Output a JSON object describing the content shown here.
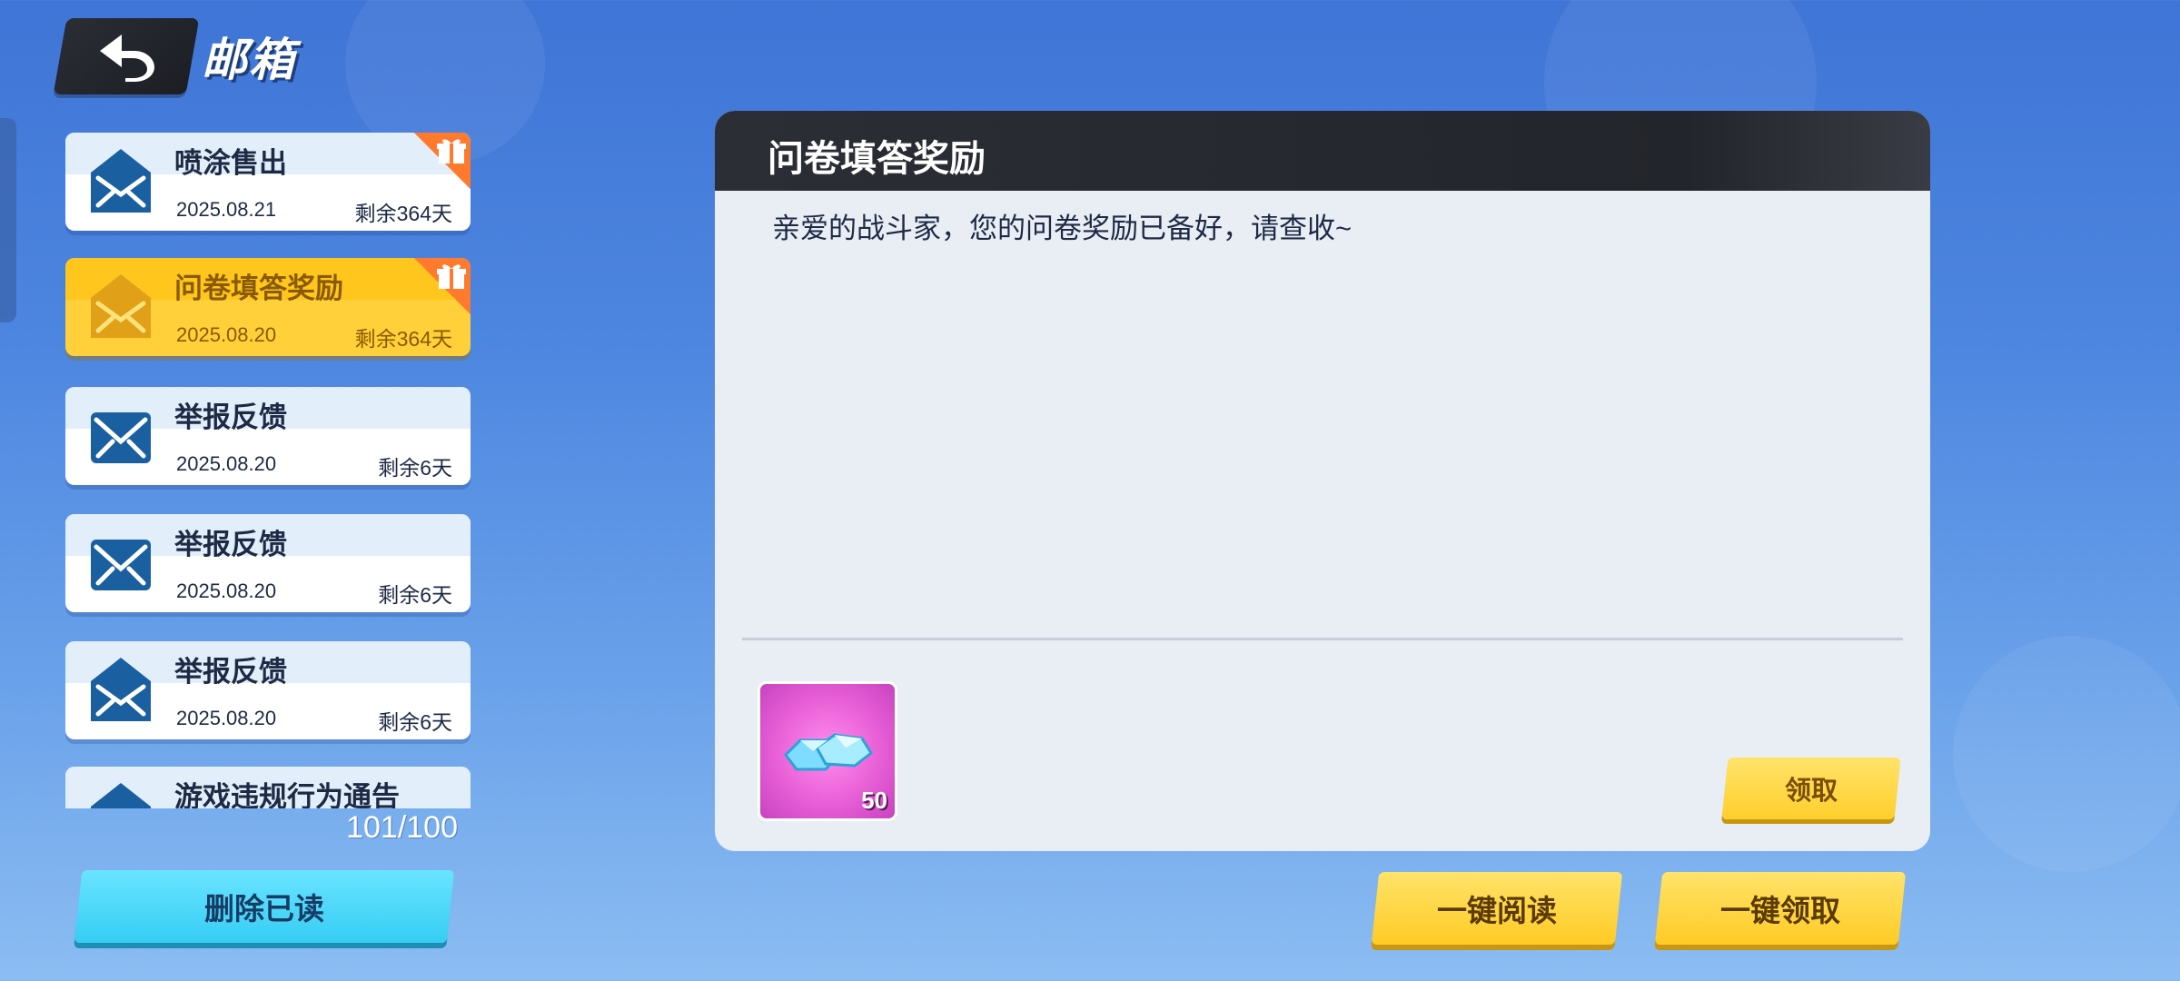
{
  "header": {
    "title": "邮箱",
    "back_icon": "back-arrow-icon"
  },
  "mails": [
    {
      "title": "喷涂售出",
      "date": "2025.08.21",
      "remain": "剩余364天",
      "has_gift": true,
      "selected": false
    },
    {
      "title": "问卷填答奖励",
      "date": "2025.08.20",
      "remain": "剩余364天",
      "has_gift": true,
      "selected": true
    },
    {
      "title": "举报反馈",
      "date": "2025.08.20",
      "remain": "剩余6天",
      "has_gift": false,
      "selected": false
    },
    {
      "title": "举报反馈",
      "date": "2025.08.20",
      "remain": "剩余6天",
      "has_gift": false,
      "selected": false
    },
    {
      "title": "举报反馈",
      "date": "2025.08.20",
      "remain": "剩余6天",
      "has_gift": false,
      "selected": false
    },
    {
      "title": "游戏违规行为通告",
      "date": "",
      "remain": "",
      "has_gift": false,
      "selected": false
    }
  ],
  "mail_count": "101/100",
  "buttons": {
    "delete_read": "删除已读",
    "claim": "领取",
    "read_all": "一键阅读",
    "claim_all": "一键领取"
  },
  "detail": {
    "title": "问卷填答奖励",
    "body": "亲爱的战斗家，您的问卷奖励已备好，请查收~",
    "reward": {
      "icon": "diamond-gem-icon",
      "quantity": "50"
    }
  },
  "colors": {
    "selected_mail": "#ffd03a",
    "mail_icon": "#1a5fa0",
    "accent_yellow": "#ffcf2c",
    "accent_cyan": "#36cdf4",
    "gift_badge": "#ff7a2d"
  }
}
